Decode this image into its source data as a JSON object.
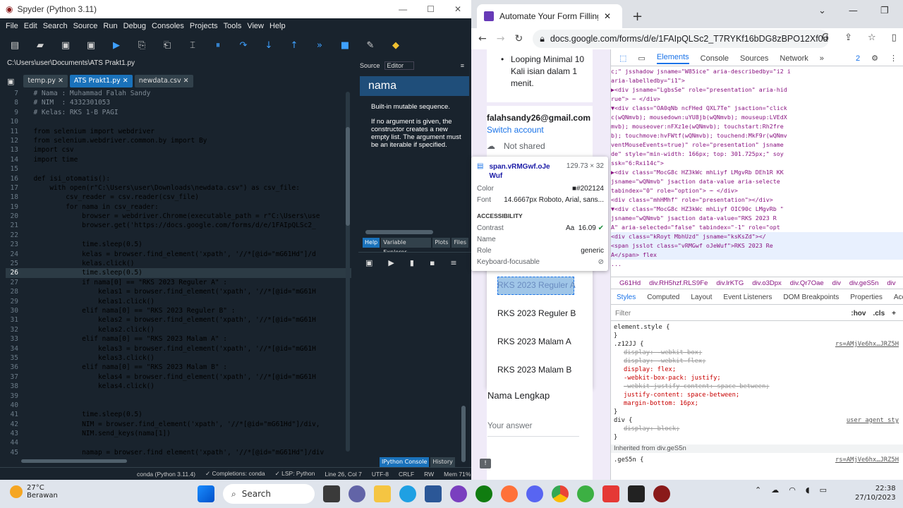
{
  "spyder": {
    "title": "Spyder (Python 3.11)",
    "menu": [
      "File",
      "Edit",
      "Search",
      "Source",
      "Run",
      "Debug",
      "Consoles",
      "Projects",
      "Tools",
      "View",
      "Help"
    ],
    "path": "C:\\Users\\user\\Documents\\ATS Prakt1.py",
    "tabs": [
      "temp.py",
      "ATS Prakt1.py",
      "newdata.csv"
    ],
    "code": [
      {
        "n": "7",
        "t": "  # Nama : Muhammad Falah Sandy",
        "c": "cm"
      },
      {
        "n": "8",
        "t": "  # NIM  : 4332301053",
        "c": "cm"
      },
      {
        "n": "9",
        "t": "  # Kelas: RKS 1-B PAGI",
        "c": "cm"
      },
      {
        "n": "10",
        "t": "",
        "c": ""
      },
      {
        "n": "11",
        "t": "  from selenium import webdriver",
        "c": ""
      },
      {
        "n": "12",
        "t": "  from selenium.webdriver.common.by import By",
        "c": ""
      },
      {
        "n": "13",
        "t": "  import csv",
        "c": ""
      },
      {
        "n": "14",
        "t": "  import time",
        "c": ""
      },
      {
        "n": "15",
        "t": "",
        "c": ""
      },
      {
        "n": "16",
        "t": "  def isi_otomatis():",
        "c": ""
      },
      {
        "n": "17",
        "t": "      with open(r\"C:\\Users\\user\\Downloads\\newdata.csv\") as csv_file:",
        "c": ""
      },
      {
        "n": "18",
        "t": "          csv_reader = csv.reader(csv_file)",
        "c": ""
      },
      {
        "n": "19",
        "t": "          for nama in csv_reader:",
        "c": ""
      },
      {
        "n": "20",
        "t": "              browser = webdriver.Chrome(executable_path = r\"C:\\Users\\use",
        "c": ""
      },
      {
        "n": "21",
        "t": "              browser.get('https://docs.google.com/forms/d/e/1FAIpQLSc2_",
        "c": ""
      },
      {
        "n": "22",
        "t": "",
        "c": ""
      },
      {
        "n": "23",
        "t": "              time.sleep(0.5)",
        "c": ""
      },
      {
        "n": "24",
        "t": "              kelas = browser.find_element('xpath', '//*[@id=\"mG61Hd\"]/d",
        "c": ""
      },
      {
        "n": "25",
        "t": "              kelas.click()",
        "c": ""
      },
      {
        "n": "26",
        "t": "              time.sleep(0.5)",
        "c": "cur"
      },
      {
        "n": "27",
        "t": "              if nama[0] == \"RKS 2023 Reguler A\" :",
        "c": ""
      },
      {
        "n": "28",
        "t": "                  kelas1 = browser.find_element('xpath', '//*[@id=\"mG61H",
        "c": ""
      },
      {
        "n": "29",
        "t": "                  kelas1.click()",
        "c": ""
      },
      {
        "n": "30",
        "t": "              elif nama[0] == \"RKS 2023 Reguler B\" :",
        "c": ""
      },
      {
        "n": "31",
        "t": "                  kelas2 = browser.find_element('xpath', '//*[@id=\"mG61H",
        "c": ""
      },
      {
        "n": "32",
        "t": "                  kelas2.click()",
        "c": ""
      },
      {
        "n": "33",
        "t": "              elif nama[0] == \"RKS 2023 Malam A\" :",
        "c": ""
      },
      {
        "n": "34",
        "t": "                  kelas3 = browser.find_element('xpath', '//*[@id=\"mG61H",
        "c": ""
      },
      {
        "n": "35",
        "t": "                  kelas3.click()",
        "c": ""
      },
      {
        "n": "36",
        "t": "              elif nama[0] == \"RKS 2023 Malam B\" :",
        "c": ""
      },
      {
        "n": "37",
        "t": "                  kelas4 = browser.find_element('xpath', '//*[@id=\"mG61H",
        "c": ""
      },
      {
        "n": "38",
        "t": "                  kelas4.click()",
        "c": ""
      },
      {
        "n": "39",
        "t": "",
        "c": ""
      },
      {
        "n": "40",
        "t": "",
        "c": ""
      },
      {
        "n": "41",
        "t": "              time.sleep(0.5)",
        "c": ""
      },
      {
        "n": "42",
        "t": "              NIM = browser.find_element('xpath', '//*[@id=\"mG61Hd\"]/div,",
        "c": ""
      },
      {
        "n": "43",
        "t": "              NIM.send_keys(nama[1])",
        "c": ""
      },
      {
        "n": "44",
        "t": "",
        "c": ""
      },
      {
        "n": "45",
        "t": "              namap = browser.find_element('xpath', '//*[@id=\"mG61Hd\"]/div",
        "c": ""
      }
    ],
    "help": {
      "source_label": "Source",
      "editor_label": "Editor",
      "title": "nama",
      "p1": "Built-in mutable sequence.",
      "p2": "If no argument is given, the constructor creates a new empty list. The argument must be an iterable if specified.",
      "tabs": [
        "Help",
        "Variable Explorer",
        "Plots",
        "Files"
      ]
    },
    "console_tabs": [
      "IPython Console",
      "History"
    ],
    "status": [
      "conda (Python 3.11.4)",
      "✓ Completions: conda",
      "✓ LSP: Python",
      "Line 26, Col 7",
      "UTF-8",
      "CRLF",
      "RW",
      "Mem 71%"
    ]
  },
  "chrome": {
    "tab_title": "Automate Your Form Filling (RKS",
    "url": "docs.google.com/forms/d/e/1FAIpQLSc2_T7RYKf16bDG8zBPO12Xf0d...",
    "devtools_tabs": [
      "Elements",
      "Console",
      "Sources",
      "Network"
    ],
    "issues": "2"
  },
  "form": {
    "bullet": "Looping Minimal 10 Kali isian dalam 1 menit.",
    "email": "falahsandy26@gmail.com",
    "switch": "Switch account",
    "not_shared": "Not shared",
    "options": [
      "RKS 2023 Reguler A",
      "RKS 2023 Reguler B",
      "RKS 2023 Malam A",
      "RKS 2023 Malam B"
    ],
    "nama_label": "Nama  Lengkap",
    "answer_placeholder": "Your answer"
  },
  "tooltip": {
    "element": "span.vRMGwf.oJe Wuf",
    "size": "129.73 × 32",
    "color_label": "Color",
    "color_value": "#202124",
    "font_label": "Font",
    "font_value": "14.6667px Roboto, Arial, sans...",
    "access_title": "ACCESSIBILITY",
    "contrast_label": "Contrast",
    "contrast_value": "16.09",
    "name_label": "Name",
    "role_label": "Role",
    "role_value": "generic",
    "kb_label": "Keyboard-focusable"
  },
  "dom": [
    "  c;\" jsshadow jsname=\"W85ice\" aria-describedby=\"i2 i",
    "  aria-labelledby=\"i1\">",
    " ▶<div jsname=\"LgbsSe\" role=\"presentation\" aria-hid",
    "   rue\"> ⋯ </div>",
    " ▼<div class=\"OA0qNb ncFHed QXL7Te\" jsaction=\"click",
    "   c(wQNmvb); mousedown:uYU8jb(wQNmvb); mouseup:LVEdX",
    "   mvb); mouseover:nFXz1e(wQNmvb); touchstart:Rh2fre",
    "   b); touchmove:hvFWtf(wQNmvb); touchend:MkF9r(wQNmv",
    "   ventMouseEvents=true)\" role=\"presentation\" jsname",
    "   de\" style=\"min-width: 166px; top: 301.725px;\" soy",
    "   ssk=\"6:Rxi14c\">",
    "  ▶<div class=\"MocG8c HZ3kWc mhLiyf LMgvRb DEh1R KK",
    "     jsname=\"wQNmvb\" jsaction data-value aria-selecte",
    "     tabindex=\"0\" role=\"option\"> ⋯ </div>",
    "    <div class=\"mhHMhf\" role=\"presentation\"></div>",
    "  ▼<div class=\"MocG8c HZ3kWc mhLiyf OIC90c LMgvRb \"",
    "     jsname=\"wQNmvb\" jsaction data-value=\"RKS 2023 R",
    "     A\" aria-selected=\"false\" tabindex=\"-1\" role=\"opt",
    "      <div class=\"kRoyt MbhUzd\" jsname=\"ksKsZd\"></",
    "      <span jsslot class=\"vRMGwf oJeWuf\">RKS 2023 Re",
    "      A</span> flex",
    "  ..."
  ],
  "crumbs": [
    "G61Hd",
    "div.RH5hzf.RLS9Fe",
    "div.lrKTG",
    "div.o3Dpx",
    "div.Qr7Oae",
    "div",
    "div.geS5n",
    "div"
  ],
  "styles_tabs": [
    "Styles",
    "Computed",
    "Layout",
    "Event Listeners",
    "DOM Breakpoints",
    "Properties",
    "Acc"
  ],
  "filter": {
    "placeholder": "Filter",
    "hov": ":hov",
    ".cls": ".cls"
  },
  "styles": [
    {
      "t": "element.style {",
      "k": "sel"
    },
    {
      "t": "}",
      "k": "sel"
    },
    {
      "t": ".z12JJ {",
      "k": "sel",
      "src": "rs=AMjVe6hx…JRZ5H"
    },
    {
      "t": "display: -webkit-box;",
      "k": "del"
    },
    {
      "t": "display: -webkit-flex;",
      "k": "del"
    },
    {
      "t": "display: flex;",
      "k": "p"
    },
    {
      "t": "-webkit-box-pack: justify;",
      "k": "p"
    },
    {
      "t": "-webkit-justify-content: space-between;",
      "k": "del"
    },
    {
      "t": "justify-content: space-between;",
      "k": "p"
    },
    {
      "t": "margin-bottom: 16px;",
      "k": "p"
    },
    {
      "t": "}",
      "k": "sel"
    },
    {
      "t": "div {",
      "k": "sel",
      "src": "user agent sty"
    },
    {
      "t": "display: block;",
      "k": "del"
    },
    {
      "t": "}",
      "k": "sel"
    },
    {
      "t": "Inherited from div.geS5n",
      "k": "inh"
    },
    {
      "t": ".geS5n {",
      "k": "sel",
      "src": "rs=AMjVe6hx…JRZ5H"
    }
  ],
  "taskbar": {
    "temp": "27°C",
    "weather": "Berawan",
    "search": "Search",
    "time": "22:38",
    "date": "27/10/2023"
  }
}
